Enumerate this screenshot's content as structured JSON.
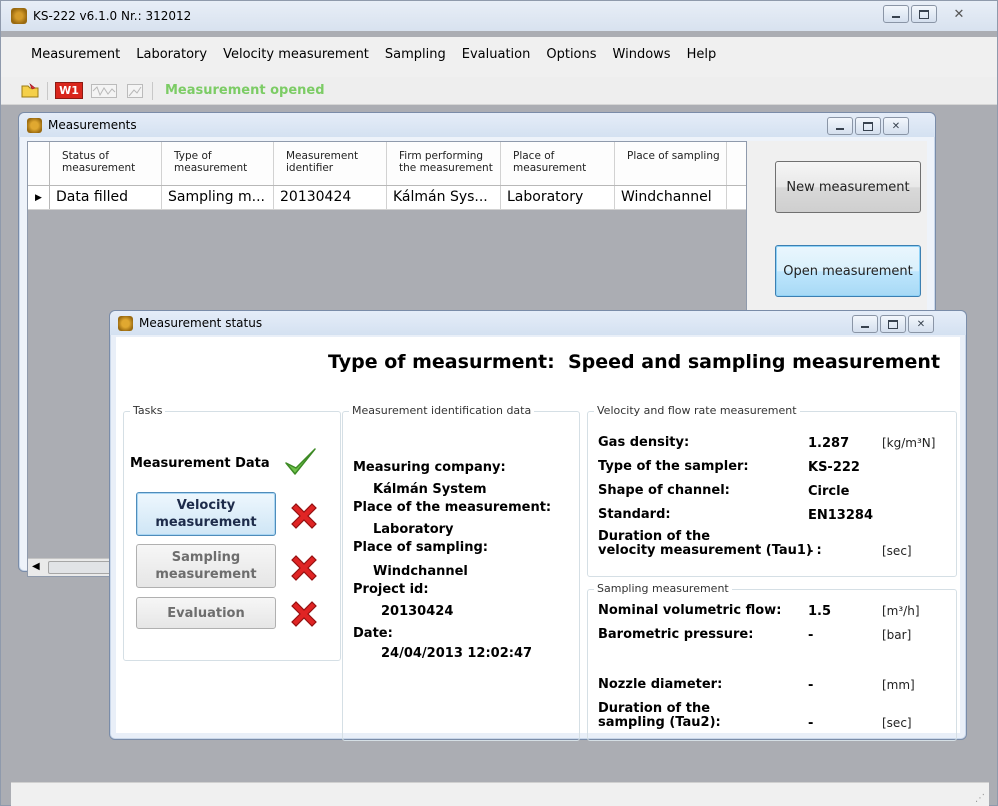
{
  "app": {
    "title": "KS-222 v6.1.0 Nr.: 312012",
    "menu": [
      "Measurement",
      "Laboratory",
      "Velocity measurement",
      "Sampling",
      "Evaluation",
      "Options",
      "Windows",
      "Help"
    ],
    "toolbar": {
      "w1_label": "W1",
      "status_text": "Measurement opened"
    }
  },
  "measurements_window": {
    "title": "Measurements",
    "columns": [
      "Status of measurement",
      "Type of measurement",
      "Measurement identifier",
      "Firm performing the measurement",
      "Place of measurement",
      "Place of sampling"
    ],
    "rows": [
      [
        "Data filled",
        "Sampling m...",
        "20130424",
        "Kálmán Sys...",
        "Laboratory",
        "Windchannel"
      ]
    ],
    "new_button": "New measurement",
    "open_button": "Open measurement"
  },
  "status_window": {
    "title": "Measurement status",
    "type_label": "Type of measurment:",
    "type_value": "Speed and sampling measurement",
    "tasks": {
      "legend": "Tasks",
      "measurement_data": "Measurement Data",
      "velocity_button": "Velocity measurement",
      "sampling_button": "Sampling measurement",
      "evaluation_button": "Evaluation"
    },
    "identification": {
      "legend": "Measurement identification data",
      "company_label": "Measuring company:",
      "company_value": "Kálmán System",
      "place_label": "Place of the measurement:",
      "place_value": "Laboratory",
      "sampling_place_label": "Place of sampling:",
      "sampling_place_value": "Windchannel",
      "project_label": "Project id:",
      "project_value": "20130424",
      "date_label": "Date:",
      "date_value": "24/04/2013 12:02:47"
    },
    "velocity": {
      "legend": "Velocity and flow rate measurement",
      "gas_density_label": "Gas density:",
      "gas_density_value": "1.287",
      "gas_density_unit": "[kg/m³N]",
      "sampler_label": "Type of the sampler:",
      "sampler_value": "KS-222",
      "shape_label": "Shape of channel:",
      "shape_value": "Circle",
      "standard_label": "Standard:",
      "standard_value": "EN13284",
      "tau1_label_1": "Duration of the",
      "tau1_label_2": "velocity measurement (Tau1) :",
      "tau1_value": "-",
      "tau1_unit": "[sec]"
    },
    "sampling": {
      "legend": "Sampling measurement",
      "flow_label": "Nominal volumetric flow:",
      "flow_value": "1.5",
      "flow_unit": "[m³/h]",
      "baro_label": "Barometric pressure:",
      "baro_value": "-",
      "baro_unit": "[bar]",
      "nozzle_label": "Nozzle diameter:",
      "nozzle_value": "-",
      "nozzle_unit": "[mm]",
      "tau2_label_1": "Duration of the",
      "tau2_label_2": "sampling (Tau2):",
      "tau2_value": "-",
      "tau2_unit": "[sec]"
    }
  }
}
